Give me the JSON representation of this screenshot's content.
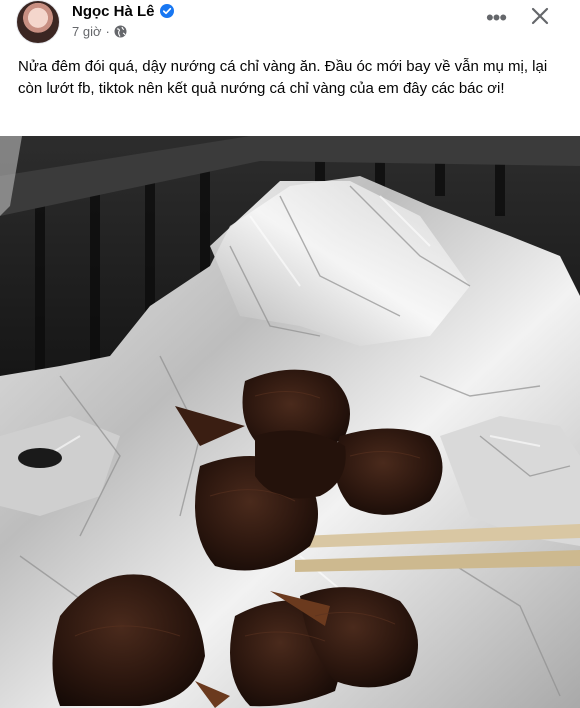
{
  "post": {
    "author_name": "Ngọc Hà Lê",
    "time": "7 giờ",
    "separator": "·",
    "text": "Nửa đêm đói quá, dậy nướng cá chỉ vàng ăn. Đầu óc mới bay về vẫn mụ mị, lại còn lướt fb, tiktok nên kết quả nướng cá chỉ vàng của em đây các bác ơi!",
    "privacy_icon": "globe-icon",
    "verified_icon": "verified-badge-icon"
  },
  "actions": {
    "more_label": "•••",
    "close_icon": "close-icon"
  },
  "colors": {
    "verified_blue": "#1877f2",
    "secondary_text": "#65676b",
    "primary_text": "#050505"
  }
}
